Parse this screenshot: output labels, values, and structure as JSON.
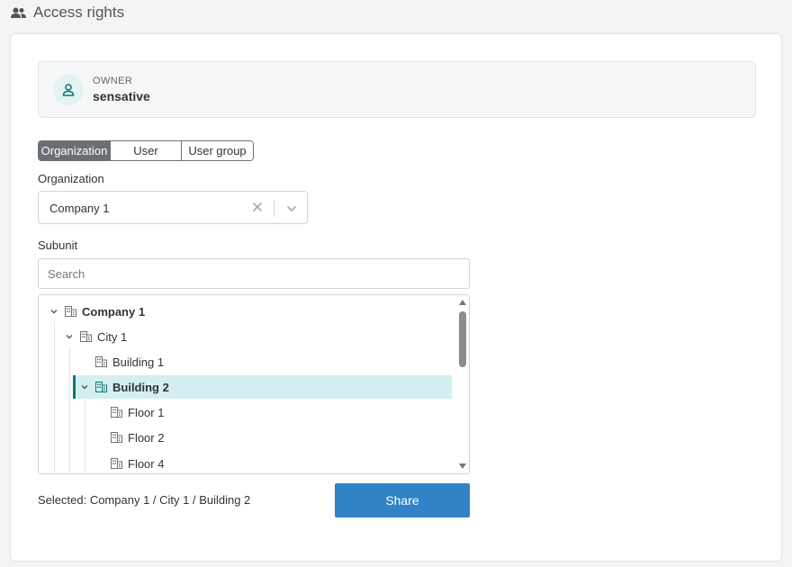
{
  "header": {
    "title": "Access rights",
    "icon": "users-icon"
  },
  "owner": {
    "label": "OWNER",
    "name": "sensative",
    "icon": "person-icon",
    "accent": "#11796f"
  },
  "share_type": {
    "options": [
      "Organization",
      "User",
      "User group"
    ],
    "active": "Organization"
  },
  "organization": {
    "label": "Organization",
    "selected": "Company 1"
  },
  "subunit": {
    "label": "Subunit",
    "search_placeholder": "Search",
    "tree": [
      {
        "label": "Company 1",
        "expanded": true,
        "bold": true
      },
      {
        "label": "City 1",
        "expanded": true
      },
      {
        "label": "Building 1"
      },
      {
        "label": "Building 2",
        "expanded": true,
        "selected": true,
        "bold": true
      },
      {
        "label": "Floor 1"
      },
      {
        "label": "Floor 2"
      },
      {
        "label": "Floor 4"
      }
    ]
  },
  "footer": {
    "selected_text": "Selected: Company 1 / City 1 / Building 2",
    "share_label": "Share"
  },
  "colors": {
    "share_button": "#2f83c6",
    "selected_row_bg": "#d3eff1",
    "selected_row_bar": "#11796f",
    "segment_active": "#6b6f75"
  }
}
